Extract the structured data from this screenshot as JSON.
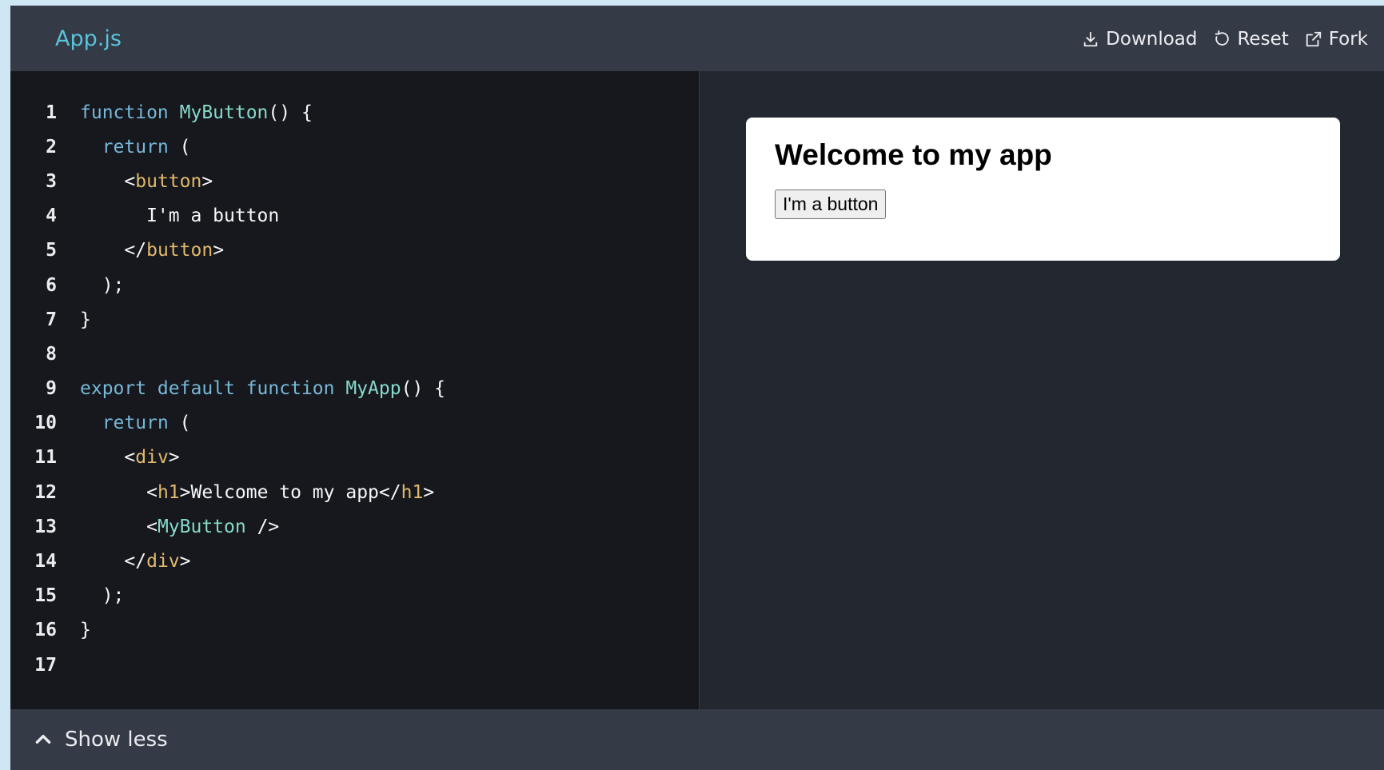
{
  "header": {
    "file_tab": "App.js",
    "actions": {
      "download": {
        "label": "Download",
        "icon": "download-icon"
      },
      "reset": {
        "label": "Reset",
        "icon": "reset-icon"
      },
      "fork": {
        "label": "Fork",
        "icon": "external-link-icon"
      }
    }
  },
  "editor": {
    "lines": [
      [
        {
          "t": "function ",
          "c": "kw"
        },
        {
          "t": "MyButton",
          "c": "fn"
        },
        {
          "t": "() {",
          "c": "punc"
        }
      ],
      [
        {
          "t": "  ",
          "c": "punc"
        },
        {
          "t": "return",
          "c": "kw"
        },
        {
          "t": " (",
          "c": "punc"
        }
      ],
      [
        {
          "t": "    <",
          "c": "punc"
        },
        {
          "t": "button",
          "c": "tag"
        },
        {
          "t": ">",
          "c": "punc"
        }
      ],
      [
        {
          "t": "      I'm a button",
          "c": "punc"
        }
      ],
      [
        {
          "t": "    </",
          "c": "punc"
        },
        {
          "t": "button",
          "c": "tag"
        },
        {
          "t": ">",
          "c": "punc"
        }
      ],
      [
        {
          "t": "  );",
          "c": "punc"
        }
      ],
      [
        {
          "t": "}",
          "c": "punc"
        }
      ],
      [],
      [
        {
          "t": "export default function ",
          "c": "kw"
        },
        {
          "t": "MyApp",
          "c": "fn"
        },
        {
          "t": "() {",
          "c": "punc"
        }
      ],
      [
        {
          "t": "  ",
          "c": "punc"
        },
        {
          "t": "return",
          "c": "kw"
        },
        {
          "t": " (",
          "c": "punc"
        }
      ],
      [
        {
          "t": "    <",
          "c": "punc"
        },
        {
          "t": "div",
          "c": "tag"
        },
        {
          "t": ">",
          "c": "punc"
        }
      ],
      [
        {
          "t": "      <",
          "c": "punc"
        },
        {
          "t": "h1",
          "c": "tag"
        },
        {
          "t": ">Welcome to my app</",
          "c": "punc"
        },
        {
          "t": "h1",
          "c": "tag"
        },
        {
          "t": ">",
          "c": "punc"
        }
      ],
      [
        {
          "t": "      <",
          "c": "punc"
        },
        {
          "t": "MyButton",
          "c": "comp"
        },
        {
          "t": " />",
          "c": "punc"
        }
      ],
      [
        {
          "t": "    </",
          "c": "punc"
        },
        {
          "t": "div",
          "c": "tag"
        },
        {
          "t": ">",
          "c": "punc"
        }
      ],
      [
        {
          "t": "  );",
          "c": "punc"
        }
      ],
      [
        {
          "t": "}",
          "c": "punc"
        }
      ],
      []
    ]
  },
  "preview": {
    "heading": "Welcome to my app",
    "button_label": "I'm a button"
  },
  "footer": {
    "toggle_label": "Show less",
    "toggle_icon": "chevron-up-icon"
  },
  "colors": {
    "accent": "#58c4dc",
    "keyword": "#77b7d7",
    "function": "#86d9ca",
    "tag": "#e2b86b",
    "editor_bg": "#16181d",
    "panel_bg": "#23272f",
    "bar_bg": "#343a46"
  }
}
